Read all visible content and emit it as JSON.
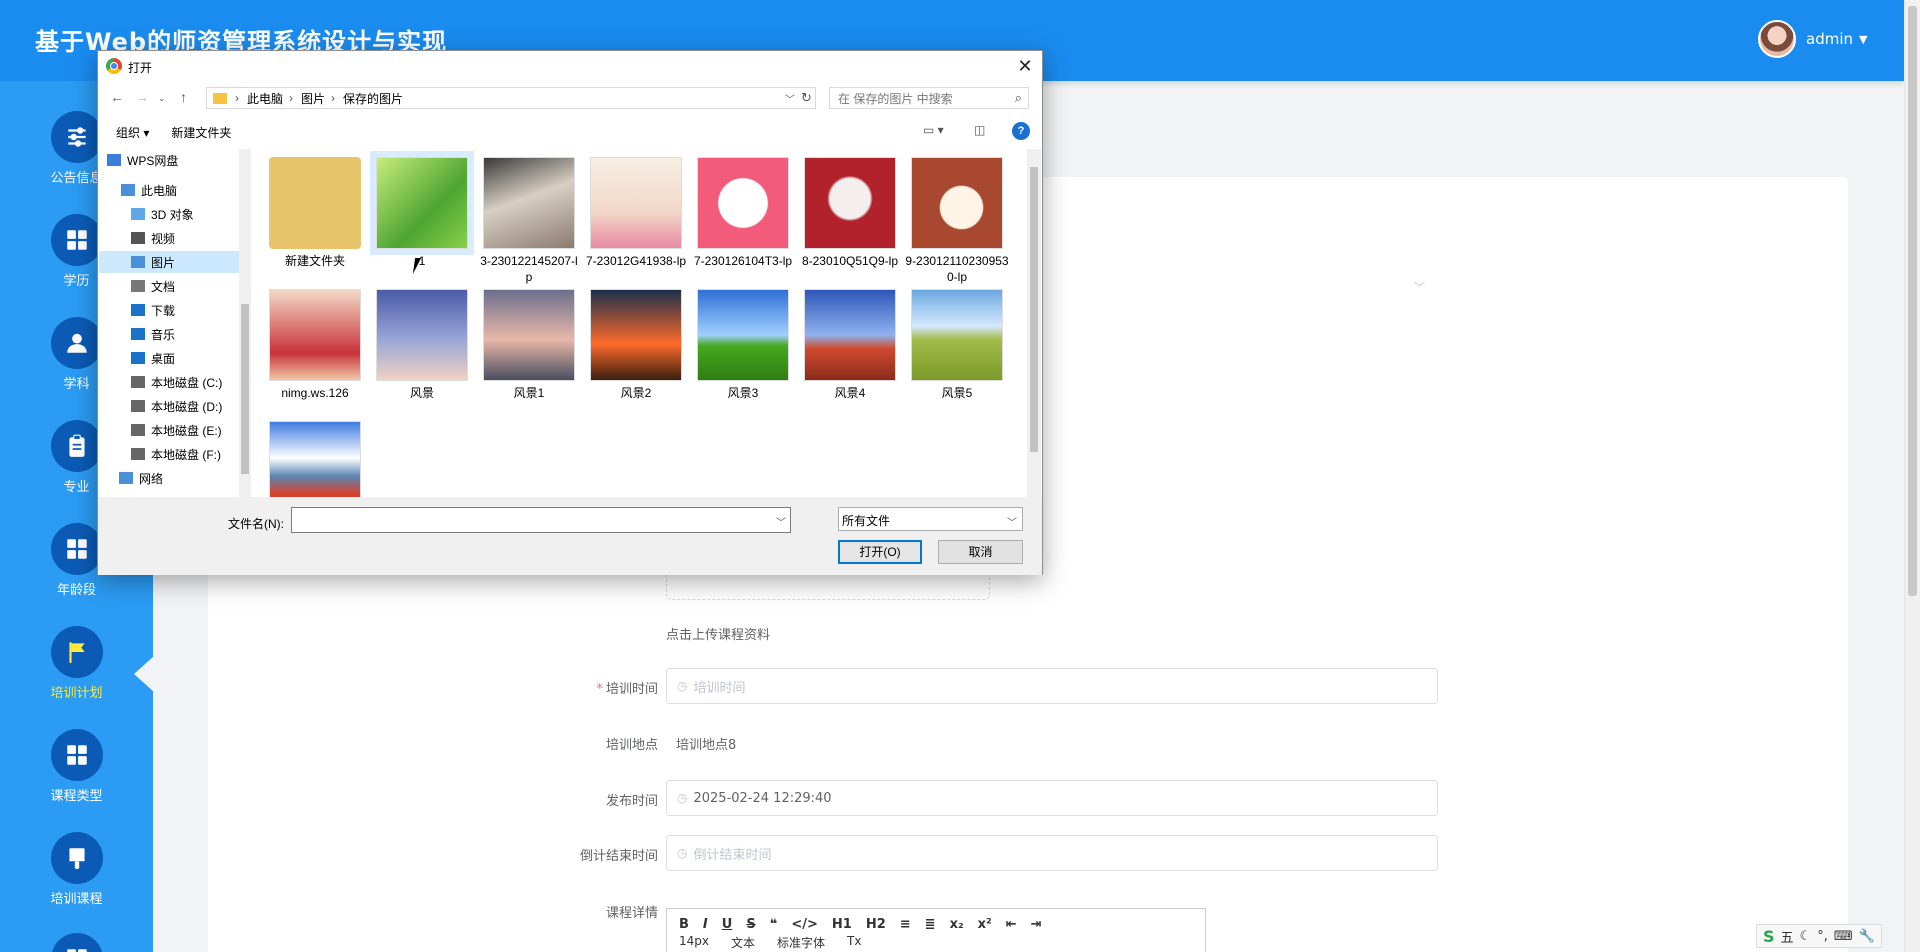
{
  "app": {
    "title": "基于Web的师资管理系统设计与实现",
    "user_name": "admin"
  },
  "sidebar": {
    "items": [
      {
        "label": "公告信息",
        "icon": "sliders-icon"
      },
      {
        "label": "学历",
        "icon": "grid-icon"
      },
      {
        "label": "学科",
        "icon": "user-icon"
      },
      {
        "label": "专业",
        "icon": "clipboard-icon"
      },
      {
        "label": "年龄段",
        "icon": "grid-icon"
      },
      {
        "label": "培训计划",
        "icon": "flag-icon",
        "active": true
      },
      {
        "label": "课程类型",
        "icon": "grid-icon"
      },
      {
        "label": "培训课程",
        "icon": "brush-icon"
      }
    ]
  },
  "form": {
    "upload_hint": "点击上传课程资料",
    "train_time_label": "培训时间",
    "train_time_placeholder": "培训时间",
    "location_label": "培训地点",
    "location_value": "培训地点8",
    "publish_label": "发布时间",
    "publish_value": "2025-02-24 12:29:40",
    "countdown_label": "倒计结束时间",
    "countdown_placeholder": "倒计结束时间",
    "detail_label": "课程详情",
    "editor": {
      "row1": [
        "B",
        "I",
        "U",
        "S",
        "❝",
        "</>",
        "H1",
        "H2",
        "≡",
        "≣",
        "x₂",
        "x²",
        "⇤",
        "⇥"
      ],
      "font_size": "14px",
      "block": "文本",
      "font_family": "标准字体",
      "clear_icon": "Tx"
    }
  },
  "dialog": {
    "title": "打开",
    "breadcrumb": [
      "此电脑",
      "图片",
      "保存的图片"
    ],
    "search_placeholder": "在 保存的图片 中搜索",
    "organize": "组织 ▾",
    "new_folder": "新建文件夹",
    "tree": [
      {
        "label": "WPS网盘",
        "icon": "cloud-icon",
        "color": "#3b7ddd"
      },
      {
        "label": "此电脑",
        "icon": "computer-icon",
        "color": "#4a90d9"
      },
      {
        "label": "3D 对象",
        "icon": "cube-icon",
        "color": "#5fa8e8"
      },
      {
        "label": "视频",
        "icon": "video-icon",
        "color": "#555555"
      },
      {
        "label": "图片",
        "icon": "picture-icon",
        "color": "#4a90d9",
        "selected": true
      },
      {
        "label": "文档",
        "icon": "document-icon",
        "color": "#777777"
      },
      {
        "label": "下载",
        "icon": "download-icon",
        "color": "#1a73c8"
      },
      {
        "label": "音乐",
        "icon": "music-icon",
        "color": "#1a73c8"
      },
      {
        "label": "桌面",
        "icon": "desktop-icon",
        "color": "#1a73c8"
      },
      {
        "label": "本地磁盘 (C:)",
        "icon": "drive-icon",
        "color": "#666666"
      },
      {
        "label": "本地磁盘 (D:)",
        "icon": "drive-icon",
        "color": "#666666"
      },
      {
        "label": "本地磁盘 (E:)",
        "icon": "drive-icon",
        "color": "#666666"
      },
      {
        "label": "本地磁盘 (F:)",
        "icon": "drive-icon",
        "color": "#666666"
      },
      {
        "label": "网络",
        "icon": "network-icon",
        "color": "#4a90d9"
      }
    ],
    "files": [
      {
        "name": "新建文件夹",
        "kind": "folder",
        "bg": "#e8c46a"
      },
      {
        "name": "1",
        "kind": "image",
        "bg": "linear-gradient(135deg,#c6ec7b,#4ea532 60%,#87cf4a)",
        "selected": true
      },
      {
        "name": "3-230122145207-lp",
        "kind": "image",
        "bg": "linear-gradient(160deg,#3a3a3a,#d8cfc4 45%,#8b7b6e)"
      },
      {
        "name": "7-23012G41938-lp",
        "kind": "image",
        "bg": "linear-gradient(180deg,#f7efe2,#f1d7c8 60%,#e98aa3)"
      },
      {
        "name": "7-230126104T3-lp",
        "kind": "image",
        "bg": "radial-gradient(circle,#ffffff 0 38%,#f25c7a 40%)"
      },
      {
        "name": "8-23010Q51Q9-lp",
        "kind": "image",
        "bg": "radial-gradient(circle at 50% 45%,#f4efee 0 30%,#b2222c 34%)"
      },
      {
        "name": "9-230121102309530-lp",
        "kind": "image",
        "bg": "radial-gradient(ellipse at 55% 55%,#fff4e5 0 30%,#a8482e 32%)"
      },
      {
        "name": "nimg.ws.126",
        "kind": "image",
        "bg": "linear-gradient(180deg,#f3d9c6,#c8323a 70%,#f0c7a6)"
      },
      {
        "name": "风景",
        "kind": "image",
        "bg": "linear-gradient(180deg,#4a5ba8,#9aa6d6 55%,#f0d1c3)"
      },
      {
        "name": "风景1",
        "kind": "image",
        "bg": "linear-gradient(180deg,#6b6f8c,#e9b7a9 55%,#4a4e60)"
      },
      {
        "name": "风景2",
        "kind": "image",
        "bg": "linear-gradient(180deg,#1b2f4c,#ff6a2a 60%,#3a1f10)"
      },
      {
        "name": "风景3",
        "kind": "image",
        "bg": "linear-gradient(180deg,#2f6fd6,#9fd0ff 50%,#45a81e 62%,#2f7d12)"
      },
      {
        "name": "风景4",
        "kind": "image",
        "bg": "linear-gradient(180deg,#2e56b8,#8fb2ee 50%,#d04b2f 65%,#8a2a1c)"
      },
      {
        "name": "风景5",
        "kind": "image",
        "bg": "linear-gradient(180deg,#6ba8e0,#d6e8ff 40%,#a3bc4a 55%,#7a9a2b)"
      },
      {
        "name": "",
        "kind": "image",
        "bg": "linear-gradient(180deg,#3f7be0,#ffffff 40%,#5b86b3 60%,#d8422c 80%)"
      }
    ],
    "filename_label": "文件名(N):",
    "filename_value": "",
    "filetype": "所有文件",
    "open_button": "打开(O)",
    "cancel_button": "取消"
  },
  "ime": {
    "text": "五"
  }
}
